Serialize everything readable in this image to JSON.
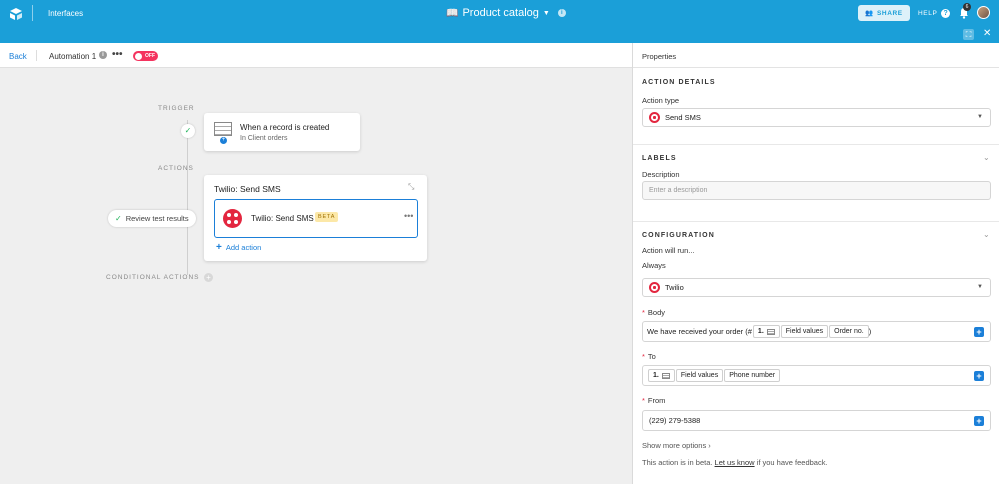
{
  "topbar": {
    "interfaces_label": "Interfaces",
    "base_title": "Product catalog",
    "share_label": "SHARE",
    "help_label": "HELP",
    "notification_count": "6"
  },
  "automation": {
    "back_label": "Back",
    "name": "Automation 1",
    "more_label": "•••",
    "toggle_label": "OFF",
    "trigger_section": "TRIGGER",
    "actions_section": "ACTIONS",
    "conditional_section": "CONDITIONAL ACTIONS",
    "trigger_title": "When a record is created",
    "trigger_subtitle": "In Client orders",
    "review_label": "Review test results",
    "action_card_title": "Twilio: Send SMS",
    "action_step_label": "Twilio: Send SMS",
    "beta_badge": "BETA",
    "step_more": "•••",
    "add_action_label": "Add action"
  },
  "properties": {
    "panel_title": "Properties",
    "action_details_heading": "ACTION DETAILS",
    "action_type_label": "Action type",
    "action_type_value": "Send SMS",
    "labels_heading": "LABELS",
    "description_label": "Description",
    "description_placeholder": "Enter a description",
    "configuration_heading": "CONFIGURATION",
    "action_will_run": "Action will run...",
    "always_label": "Always",
    "integration_value": "Twilio",
    "body_label": "Body",
    "body_text": "We have received your order (#",
    "body_token_num": "1.",
    "body_token_field": "Field values",
    "body_token_value": "Order no.",
    "body_suffix": ")",
    "to_label": "To",
    "to_token_num": "1.",
    "to_token_field": "Field values",
    "to_token_value": "Phone number",
    "from_label": "From",
    "from_value": "(229) 279-5388",
    "show_more_label": "Show more options",
    "beta_note_prefix": "This action is in beta.",
    "beta_note_link": "Let us know",
    "beta_note_suffix": "if you have feedback."
  },
  "colors": {
    "topbar": "#1b9fd8",
    "accent": "#1b7fd8",
    "twilio": "#e3263f",
    "success": "#20b35a"
  }
}
